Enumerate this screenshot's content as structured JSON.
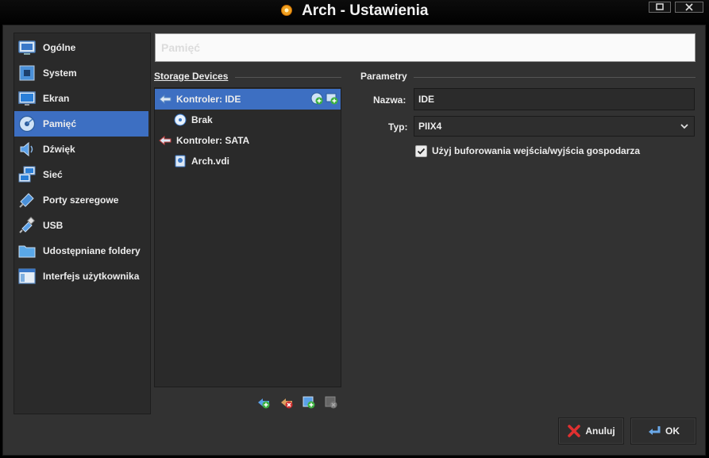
{
  "window": {
    "title": "Arch - Ustawienia"
  },
  "sidebar": {
    "items": [
      {
        "label": "Ogólne",
        "icon": "general-icon"
      },
      {
        "label": "System",
        "icon": "chip-icon"
      },
      {
        "label": "Ekran",
        "icon": "monitor-icon"
      },
      {
        "label": "Pamięć",
        "icon": "disk-icon",
        "active": true
      },
      {
        "label": "Dźwięk",
        "icon": "speaker-icon"
      },
      {
        "label": "Sieć",
        "icon": "network-icon"
      },
      {
        "label": "Porty szeregowe",
        "icon": "serial-port-icon"
      },
      {
        "label": "USB",
        "icon": "usb-icon"
      },
      {
        "label": "Udostępniane foldery",
        "icon": "folder-icon"
      },
      {
        "label": "Interfejs użytkownika",
        "icon": "window-icon"
      }
    ]
  },
  "header": {
    "title": "Pamięć"
  },
  "storage": {
    "label": "Storage Devices",
    "tree": [
      {
        "label": "Kontroler: IDE",
        "type": "controller",
        "selected": true
      },
      {
        "label": "Brak",
        "type": "optical"
      },
      {
        "label": "Kontroler: SATA",
        "type": "controller"
      },
      {
        "label": "Arch.vdi",
        "type": "disk"
      }
    ]
  },
  "params": {
    "label": "Parametry",
    "name_label": "Nazwa:",
    "name_value": "IDE",
    "type_label": "Typ:",
    "type_value": "PIIX4",
    "cache_label": "Użyj buforowania wejścia/wyjścia gospodarza",
    "cache_checked": true
  },
  "buttons": {
    "cancel": "Anuluj",
    "ok": "OK"
  },
  "colors": {
    "accent": "#3d6fc2",
    "background": "#323232",
    "panel": "#2a2a2a"
  }
}
